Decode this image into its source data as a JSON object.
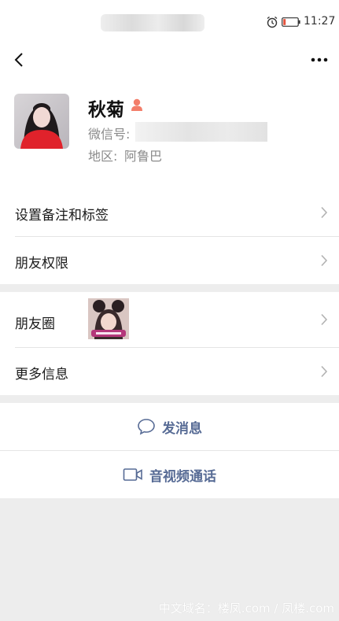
{
  "status_bar": {
    "time": "11:27"
  },
  "profile": {
    "nickname": "秋菊",
    "wechat_id_label": "微信号:",
    "region_label": "地区:",
    "region_value": "阿鲁巴"
  },
  "menu": {
    "set_remark": "设置备注和标签",
    "friend_permissions": "朋友权限",
    "moments": "朋友圈",
    "more_info": "更多信息"
  },
  "actions": {
    "send_message": "发消息",
    "av_call": "音视频通话"
  },
  "watermark": "中文域名：楼凤.com / 凤楼.com",
  "colors": {
    "link_blue": "#576b95",
    "gender_icon": "#f37e6a",
    "page_bg": "#ededed"
  }
}
